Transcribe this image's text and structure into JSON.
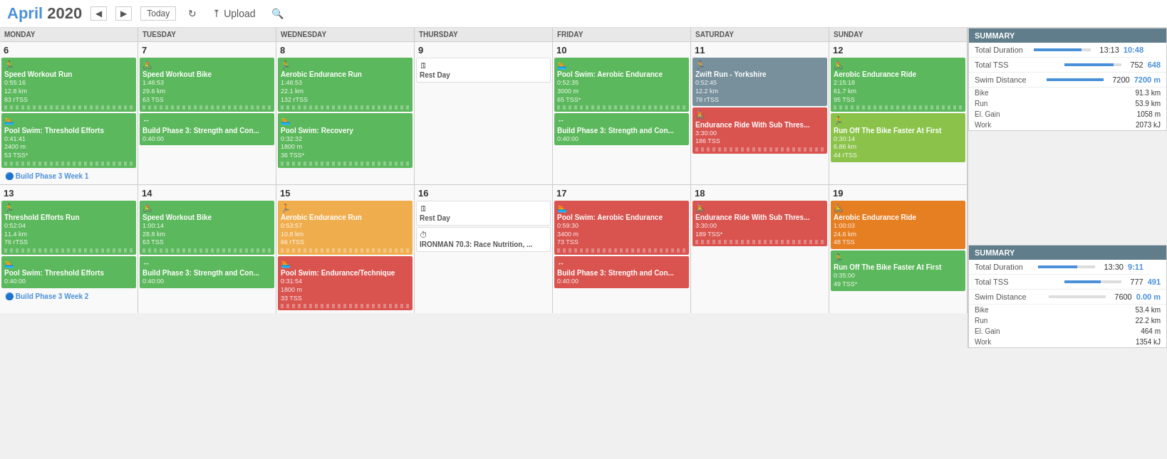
{
  "header": {
    "month": "April",
    "year": "2020",
    "today_label": "Today",
    "upload_label": "Upload"
  },
  "days_of_week": [
    "MONDAY",
    "TUESDAY",
    "WEDNESDAY",
    "THURSDAY",
    "FRIDAY",
    "SATURDAY",
    "SUNDAY"
  ],
  "week1": {
    "days": [
      6,
      7,
      8,
      9,
      10,
      11,
      12
    ],
    "label": "Build Phase 3 Week 1",
    "activities": {
      "mon": [
        {
          "type": "green",
          "icon": "🏃",
          "title": "Speed Workout Run",
          "time": "0:55:16",
          "dist": "12.8 km",
          "tss": "83 rTSS",
          "bars": true
        },
        {
          "type": "green",
          "icon": "🏊",
          "title": "Pool Swim: Threshold Efforts",
          "time": "0:41:41",
          "dist": "2400 m",
          "tss": "53 TSS*",
          "bars": true
        }
      ],
      "tue": [
        {
          "type": "green",
          "icon": "🚴",
          "title": "Speed Workout Bike",
          "time": "1:46:53",
          "dist": "29.6 km",
          "tss": "63 TSS",
          "bars": true
        },
        {
          "type": "green",
          "icon": "↔",
          "title": "Build Phase 3: Strength and Con...",
          "time": "0:40:00",
          "bars": false
        }
      ],
      "wed": [
        {
          "type": "green",
          "icon": "🏃",
          "title": "Aerobic Endurance Run",
          "time": "1:46:53",
          "dist": "22.1 km",
          "tss": "132 rTSS",
          "bars": true
        },
        {
          "type": "green",
          "icon": "🏊",
          "title": "Pool Swim: Recovery",
          "time": "0:32:32",
          "dist": "1800 m",
          "tss": "36 TSS*",
          "bars": true
        }
      ],
      "thu": [
        {
          "type": "white",
          "icon": "🗓",
          "title": "Rest Day",
          "bars": false
        }
      ],
      "fri": [
        {
          "type": "green",
          "icon": "🏊",
          "title": "Pool Swim: Aerobic Endurance",
          "time": "0:52:35",
          "dist": "3000 m",
          "tss": "65 TSS*",
          "bars": true
        },
        {
          "type": "green",
          "icon": "↔",
          "title": "Build Phase 3: Strength and Con...",
          "time": "0:40:00",
          "bars": false
        }
      ],
      "sat": [
        {
          "type": "blue-gray",
          "icon": "🏃",
          "title": "Zwift Run - Yorkshire",
          "time": "0:52:45",
          "dist": "12.2 km",
          "tss": "78 rTSS",
          "bars": false
        },
        {
          "type": "red",
          "icon": "🚴",
          "title": "Endurance Ride With Sub Thres...",
          "time": "3:30:00",
          "tss": "186 TSS",
          "bars": true
        }
      ],
      "sun": [
        {
          "type": "green",
          "icon": "🚴",
          "title": "Aerobic Endurance Ride",
          "time": "2:15:18",
          "dist": "61.7 km",
          "tss": "95 TSS",
          "bars": true
        },
        {
          "type": "light-green",
          "icon": "🏃",
          "title": "Run Off The Bike Faster At First",
          "time": "0:30:14",
          "dist": "6.86 km",
          "tss": "44 rTSS",
          "bars": false
        }
      ]
    },
    "summary": {
      "title": "SUMMARY",
      "total_duration_label": "Total Duration",
      "total_duration_planned": "13:13",
      "total_duration_actual": "10:48",
      "total_tss_label": "Total TSS",
      "total_tss_planned": "752",
      "total_tss_actual": "648",
      "swim_dist_label": "Swim Distance",
      "swim_dist_planned": "7200",
      "swim_dist_actual": "7200 m",
      "bike_label": "Bike",
      "bike_value": "91.3 km",
      "run_label": "Run",
      "run_value": "53.9 km",
      "elgain_label": "El. Gain",
      "elgain_value": "1058 m",
      "work_label": "Work",
      "work_value": "2073 kJ"
    }
  },
  "week2": {
    "days": [
      13,
      14,
      15,
      16,
      17,
      18,
      19
    ],
    "label": "Build Phase 3 Week 2",
    "activities": {
      "mon": [
        {
          "type": "green",
          "icon": "🏃",
          "title": "Threshold Efforts Run",
          "time": "0:52:04",
          "dist": "11.4 km",
          "tss": "76 rTSS",
          "bars": true
        },
        {
          "type": "green",
          "icon": "🏊",
          "title": "Pool Swim: Threshold Efforts",
          "time": "0:40:00",
          "bars": false
        }
      ],
      "tue": [
        {
          "type": "green",
          "icon": "🚴",
          "title": "Speed Workout Bike",
          "time": "1:00:14",
          "dist": "28.8 km",
          "tss": "63 TSS",
          "bars": true
        },
        {
          "type": "green",
          "icon": "↔",
          "title": "Build Phase 3: Strength and Con...",
          "time": "0:40:00",
          "bars": false
        }
      ],
      "wed": [
        {
          "type": "yellow",
          "icon": "🏃",
          "title": "Aerobic Endurance Run",
          "time": "0:53:57",
          "dist": "10.8 km",
          "tss": "66 rTSS",
          "bars": true
        },
        {
          "type": "red",
          "icon": "🏊",
          "title": "Pool Swim: Endurance/Technique",
          "time": "0:31:54",
          "dist": "1800 m",
          "tss": "33 TSS",
          "bars": true
        }
      ],
      "thu": [
        {
          "type": "white",
          "icon": "🗓",
          "title": "Rest Day",
          "bars": false
        },
        {
          "type": "white",
          "icon": "⏱",
          "title": "IRONMAN 70.3: Race Nutrition, ...",
          "bars": false
        }
      ],
      "fri": [
        {
          "type": "red",
          "icon": "🏊",
          "title": "Pool Swim: Aerobic Endurance",
          "time": "0:59:30",
          "dist": "3400 m",
          "tss": "73 TSS",
          "bars": true
        },
        {
          "type": "red",
          "icon": "↔",
          "title": "Build Phase 3: Strength and Con...",
          "time": "0:40:00",
          "bars": false
        }
      ],
      "sat": [
        {
          "type": "red",
          "icon": "🚴",
          "title": "Endurance Ride With Sub Thres...",
          "time": "3:30:00",
          "tss": "189 TSS*",
          "bars": true
        }
      ],
      "sun": [
        {
          "type": "orange",
          "icon": "🚴",
          "title": "Aerobic Endurance Ride",
          "time": "1:00:03",
          "dist": "24.6 km",
          "tss": "48 TSS",
          "bars": false
        },
        {
          "type": "green",
          "icon": "🏃",
          "title": "Run Off The Bike Faster At First",
          "time": "0:35:00",
          "tss": "49 TSS*",
          "bars": false
        }
      ]
    },
    "summary": {
      "title": "SUMMARY",
      "total_duration_label": "Total Duration",
      "total_duration_planned": "13:30",
      "total_duration_actual": "9:11",
      "total_tss_label": "Total TSS",
      "total_tss_planned": "777",
      "total_tss_actual": "491",
      "swim_dist_label": "Swim Distance",
      "swim_dist_planned": "7600",
      "swim_dist_actual": "0.00 m",
      "bike_label": "Bike",
      "bike_value": "53.4 km",
      "run_label": "Run",
      "run_value": "22.2 km",
      "elgain_label": "El. Gain",
      "elgain_value": "464 m",
      "work_label": "Work",
      "work_value": "1354 kJ"
    }
  }
}
